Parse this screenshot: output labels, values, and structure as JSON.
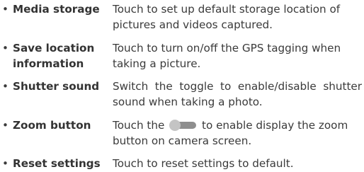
{
  "settings": [
    {
      "bullet": "•",
      "term": "Media storage",
      "description": "Touch to set up default storage location of pictures and videos captured."
    },
    {
      "bullet": "•",
      "term": "Save location information",
      "description": "Touch to turn on/off the GPS tagging when taking a picture."
    },
    {
      "bullet": "•",
      "term": "Shutter sound",
      "description": "Switch the toggle to enable/disable shutter sound when taking a photo."
    },
    {
      "bullet": "•",
      "term": "Zoom button",
      "description_before_icon": "Touch the",
      "icon": "toggle-switch-icon",
      "description_after_icon": "to enable display the zoom button on camera screen."
    },
    {
      "bullet": "•",
      "term": "Reset settings",
      "description": "Touch to reset settings to default."
    }
  ]
}
